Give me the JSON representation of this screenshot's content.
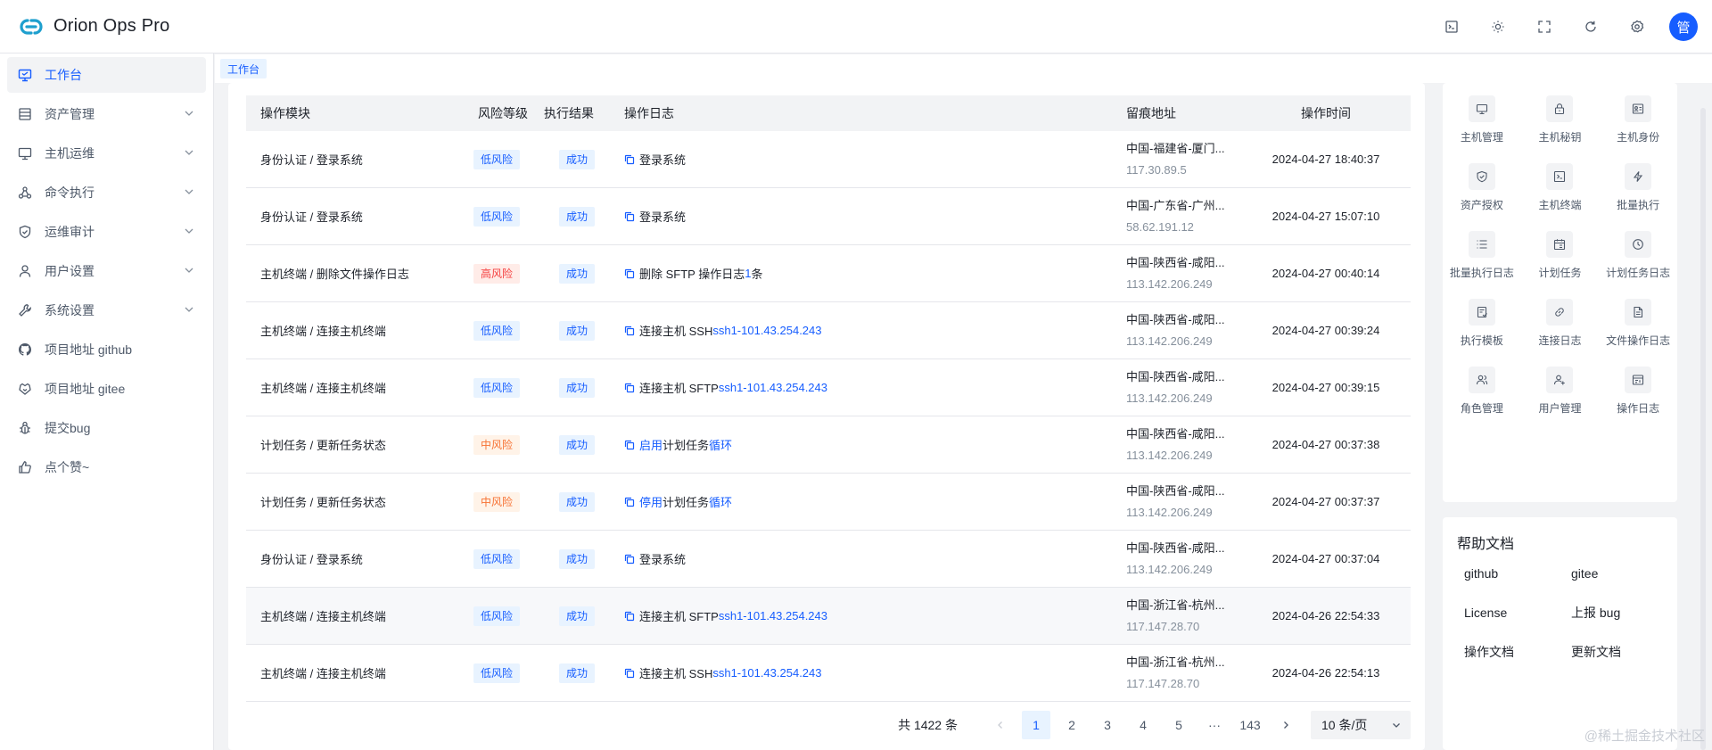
{
  "app": {
    "title": "Orion Ops Pro",
    "avatar_text": "管"
  },
  "header": {
    "actions": [
      "terminal-icon",
      "sun-icon",
      "fullscreen-icon",
      "refresh-icon",
      "gear-icon"
    ]
  },
  "sidebar": {
    "items": [
      {
        "label": "工作台",
        "active": true
      },
      {
        "label": "资产管理"
      },
      {
        "label": "主机运维"
      },
      {
        "label": "命令执行"
      },
      {
        "label": "运维审计"
      },
      {
        "label": "用户设置"
      },
      {
        "label": "系统设置"
      },
      {
        "label": "项目地址 github"
      },
      {
        "label": "项目地址 gitee"
      },
      {
        "label": "提交bug"
      },
      {
        "label": "点个赞~"
      }
    ]
  },
  "breadcrumb": {
    "tab": "工作台"
  },
  "table": {
    "headers": [
      "操作模块",
      "风险等级",
      "执行结果",
      "操作日志",
      "留痕地址",
      "操作时间"
    ],
    "rows": [
      {
        "module": "身份认证 / 登录系统",
        "risk": "低风险",
        "result": "成功",
        "log_a": "登录系统",
        "log_b": "",
        "log_c": "",
        "log_d": "",
        "addr": "中国-福建省-厦门...",
        "ip": "117.30.89.5",
        "time": "2024-04-27 18:40:37"
      },
      {
        "module": "身份认证 / 登录系统",
        "risk": "低风险",
        "result": "成功",
        "log_a": "登录系统",
        "log_b": "",
        "log_c": "",
        "log_d": "",
        "addr": "中国-广东省-广州...",
        "ip": "58.62.191.12",
        "time": "2024-04-27 15:07:10"
      },
      {
        "module": "主机终端 / 删除文件操作日志",
        "risk": "高风险",
        "result": "成功",
        "log_a": "删除 SFTP 操作日志 ",
        "log_b": "1",
        "log_c": " 条",
        "log_d": "",
        "addr": "中国-陕西省-咸阳...",
        "ip": "113.142.206.249",
        "time": "2024-04-27 00:40:14"
      },
      {
        "module": "主机终端 / 连接主机终端",
        "risk": "低风险",
        "result": "成功",
        "log_a": "连接主机 SSH ",
        "log_b": "ssh1-101.43.254.243",
        "log_c": "",
        "log_d": "",
        "addr": "中国-陕西省-咸阳...",
        "ip": "113.142.206.249",
        "time": "2024-04-27 00:39:24"
      },
      {
        "module": "主机终端 / 连接主机终端",
        "risk": "低风险",
        "result": "成功",
        "log_a": "连接主机 SFTP ",
        "log_b": "ssh1-101.43.254.243",
        "log_c": "",
        "log_d": "",
        "addr": "中国-陕西省-咸阳...",
        "ip": "113.142.206.249",
        "time": "2024-04-27 00:39:15"
      },
      {
        "module": "计划任务 / 更新任务状态",
        "risk": "中风险",
        "result": "成功",
        "log_a": "",
        "log_b": "启用",
        "log_c": " 计划任务 ",
        "log_d": "循环",
        "addr": "中国-陕西省-咸阳...",
        "ip": "113.142.206.249",
        "time": "2024-04-27 00:37:38"
      },
      {
        "module": "计划任务 / 更新任务状态",
        "risk": "中风险",
        "result": "成功",
        "log_a": "",
        "log_b": "停用",
        "log_c": " 计划任务 ",
        "log_d": "循环",
        "addr": "中国-陕西省-咸阳...",
        "ip": "113.142.206.249",
        "time": "2024-04-27 00:37:37"
      },
      {
        "module": "身份认证 / 登录系统",
        "risk": "低风险",
        "result": "成功",
        "log_a": "登录系统",
        "log_b": "",
        "log_c": "",
        "log_d": "",
        "addr": "中国-陕西省-咸阳...",
        "ip": "113.142.206.249",
        "time": "2024-04-27 00:37:04"
      },
      {
        "module": "主机终端 / 连接主机终端",
        "risk": "低风险",
        "result": "成功",
        "log_a": "连接主机 SFTP ",
        "log_b": "ssh1-101.43.254.243",
        "log_c": "",
        "log_d": "",
        "addr": "中国-浙江省-杭州...",
        "ip": "117.147.28.70",
        "time": "2024-04-26 22:54:33"
      },
      {
        "module": "主机终端 / 连接主机终端",
        "risk": "低风险",
        "result": "成功",
        "log_a": "连接主机 SSH ",
        "log_b": "ssh1-101.43.254.243",
        "log_c": "",
        "log_d": "",
        "addr": "中国-浙江省-杭州...",
        "ip": "117.147.28.70",
        "time": "2024-04-26 22:54:13"
      }
    ]
  },
  "pagination": {
    "total": "共 1422 条",
    "pages": [
      "1",
      "2",
      "3",
      "4",
      "5",
      "···",
      "143"
    ],
    "current": "1",
    "page_size": "10 条/页"
  },
  "quick_links": [
    {
      "label": "主机管理",
      "icon": "desktop-icon"
    },
    {
      "label": "主机秘钥",
      "icon": "lock-icon"
    },
    {
      "label": "主机身份",
      "icon": "id-card-icon"
    },
    {
      "label": "资产授权",
      "icon": "shield-icon"
    },
    {
      "label": "主机终端",
      "icon": "terminal-icon"
    },
    {
      "label": "批量执行",
      "icon": "bolt-icon"
    },
    {
      "label": "批量执行日志",
      "icon": "list-icon"
    },
    {
      "label": "计划任务",
      "icon": "calendar-icon"
    },
    {
      "label": "计划任务日志",
      "icon": "history-icon"
    },
    {
      "label": "执行模板",
      "icon": "template-icon"
    },
    {
      "label": "连接日志",
      "icon": "link-icon"
    },
    {
      "label": "文件操作日志",
      "icon": "file-icon"
    },
    {
      "label": "角色管理",
      "icon": "user-group-icon"
    },
    {
      "label": "用户管理",
      "icon": "user-add-icon"
    },
    {
      "label": "操作日志",
      "icon": "log-icon"
    }
  ],
  "help": {
    "title": "帮助文档",
    "links": [
      "github",
      "gitee",
      "License",
      "上报 bug",
      "操作文档",
      "更新文档"
    ]
  },
  "watermark": "@稀土掘金技术社区",
  "colors": {
    "primary": "#165dff",
    "danger": "#f53f3f",
    "warning": "#f77234",
    "bg": "#f2f3f5"
  }
}
